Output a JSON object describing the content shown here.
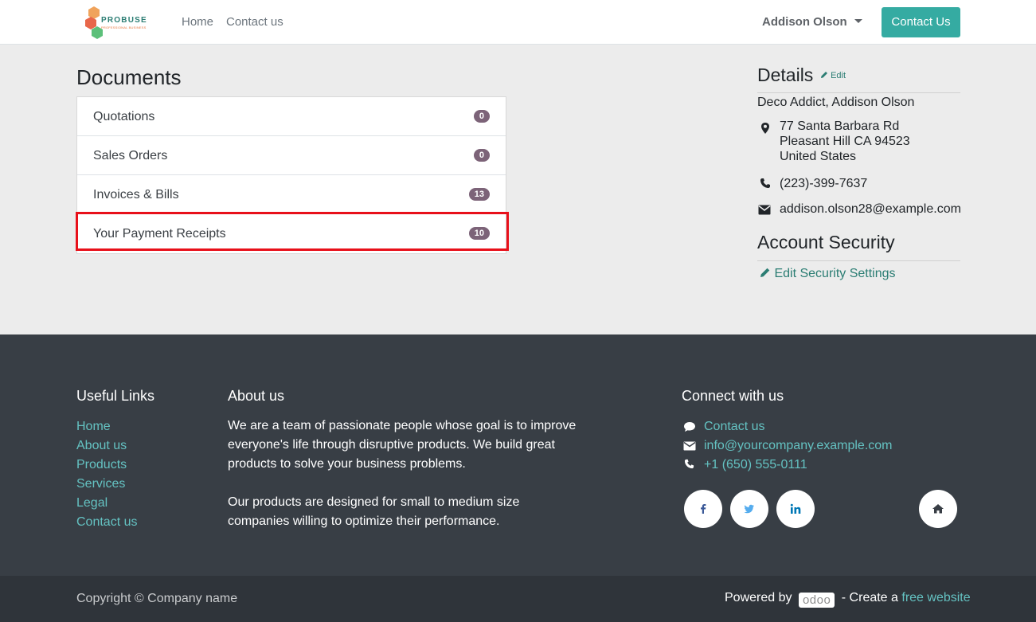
{
  "header": {
    "logo_text": "PROBUSE",
    "logo_subtext": "PROFESSIONAL BUSINESS",
    "nav": [
      {
        "label": "Home"
      },
      {
        "label": "Contact us"
      }
    ],
    "user_name": "Addison Olson",
    "cta_label": "Contact Us",
    "accent_color": "#35aba2"
  },
  "documents": {
    "title": "Documents",
    "items": [
      {
        "label": "Quotations",
        "count": "0"
      },
      {
        "label": "Sales Orders",
        "count": "0"
      },
      {
        "label": "Invoices & Bills",
        "count": "13"
      },
      {
        "label": "Your Payment Receipts",
        "count": "10"
      }
    ]
  },
  "details": {
    "title": "Details",
    "edit_label": "Edit",
    "name": "Deco Addict, Addison Olson",
    "address": [
      "77 Santa Barbara Rd",
      "Pleasant Hill CA 94523",
      "United States"
    ],
    "phone": "(223)-399-7637",
    "email": "addison.olson28@example.com"
  },
  "security": {
    "title": "Account Security",
    "edit_link": "Edit Security Settings"
  },
  "footer": {
    "useful_links_title": "Useful Links",
    "useful_links": [
      "Home",
      "About us",
      "Products",
      "Services",
      "Legal",
      "Contact us"
    ],
    "about_title": "About us",
    "about_p1": "We are a team of passionate people whose goal is to improve everyone's life through disruptive products. We build great products to solve your business problems.",
    "about_p2": "Our products are designed for small to medium size companies willing to optimize their performance.",
    "connect_title": "Connect with us",
    "connect": {
      "contact": "Contact us",
      "email": "info@yourcompany.example.com",
      "phone": "+1 (650) 555-0111"
    },
    "social_icons": [
      "facebook-icon",
      "twitter-icon",
      "linkedin-icon",
      "home-icon"
    ]
  },
  "bottom_bar": {
    "copyright": "Copyright © Company name",
    "powered_by": "Powered by",
    "odoo_label": "odoo",
    "create_text": "- Create a",
    "free_website": "free website"
  }
}
